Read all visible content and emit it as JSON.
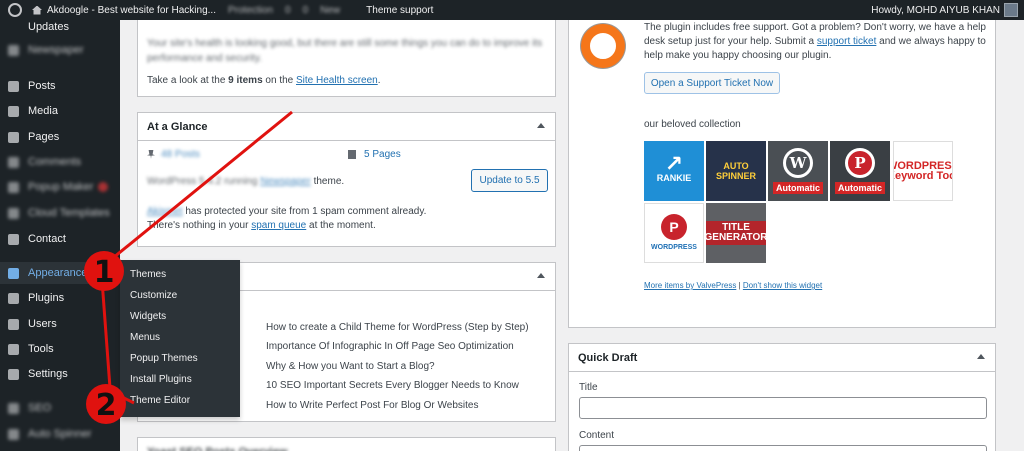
{
  "adminbar": {
    "site_name": "Akdoogle - Best website for Hacking...",
    "items_blurred": [
      "Protection",
      "0",
      "0",
      "New"
    ],
    "theme_support": "Theme support",
    "howdy": "Howdy, MOHD AIYUB KHAN"
  },
  "sidebar": {
    "items": [
      {
        "label": "Updates",
        "blurred": false
      },
      {
        "label": "Newspaper",
        "blurred": true
      },
      {
        "label": "Posts",
        "blurred": false
      },
      {
        "label": "Media",
        "blurred": false
      },
      {
        "label": "Pages",
        "blurred": false
      },
      {
        "label": "Comments",
        "blurred": false
      },
      {
        "label": "Popup Maker",
        "blurred": true
      },
      {
        "label": "Cloud Templates",
        "blurred": true
      },
      {
        "label": "Contact",
        "blurred": false
      },
      {
        "label": "Appearance",
        "blurred": false,
        "current": true
      },
      {
        "label": "Plugins",
        "blurred": false
      },
      {
        "label": "Users",
        "blurred": false
      },
      {
        "label": "Tools",
        "blurred": false
      },
      {
        "label": "Settings",
        "blurred": false
      },
      {
        "label": "SEO",
        "blurred": true
      },
      {
        "label": "Auto Spinner",
        "blurred": true
      }
    ],
    "flyout": [
      "Themes",
      "Customize",
      "Widgets",
      "Menus",
      "Popup Themes",
      "Install Plugins",
      "Theme Editor"
    ]
  },
  "site_health": {
    "text1": "Your site's health is looking good, but there are still some things you can do to improve its",
    "text2": "performance and security.",
    "items_prefix": "Take a look at the ",
    "items_count": "9 items",
    "items_mid": " on the ",
    "link": "Site Health screen",
    "items_suffix": "."
  },
  "at_a_glance": {
    "title": "At a Glance",
    "posts": "48 Posts",
    "pages": "5 Pages",
    "version_text_pre": "WordPress 5.4.2 running ",
    "theme_name": "Newspaper",
    "version_text_post": " theme.",
    "update_button": "Update to 5.5",
    "akismet_link": "Akismet",
    "akismet_text": " has protected your site from 1 spam comment already.",
    "spam_pre": "There's nothing in your ",
    "spam_link": "spam queue",
    "spam_post": " at the moment."
  },
  "activity": {
    "posts": [
      "How to create a Child Theme for WordPress (Step by Step)",
      "Importance Of Infographic In Off Page Seo Optimization",
      "Why & How you Want to Start a Blog?",
      "10 SEO Important Secrets Every Blogger Needs to Know",
      "How to Write Perfect Post For Blog Or Websites"
    ]
  },
  "yoast": {
    "title": "Yoast SEO Posts Overview"
  },
  "support": {
    "text1_pre": "The plugin includes free support. Got a problem? Don't worry, we have a help",
    "text2_pre": "desk setup just for your help. Submit a ",
    "ticket_link": "support ticket",
    "text2_post": " and we always happy to",
    "text3": "help make you happy choosing our plugin.",
    "button": "Open a Support Ticket Now",
    "collection": "our beloved collection",
    "tiles": [
      "RANKIE",
      "AUTO SPINNER",
      "Automatic",
      "Automatic",
      "WORDPRESS Keyword Tool",
      "WORDPRESS",
      "TITLE GENERATOR"
    ],
    "more_link": "More items by ValvePress",
    "separator": "|",
    "dont_show": "Don't show this widget"
  },
  "quick_draft": {
    "title": "Quick Draft",
    "title_label": "Title",
    "content_label": "Content"
  },
  "annotations": [
    "1",
    "2"
  ],
  "colors": {
    "annotation": "#e0120f",
    "accent": "#2271b1",
    "sidebar": "#1d2327"
  }
}
